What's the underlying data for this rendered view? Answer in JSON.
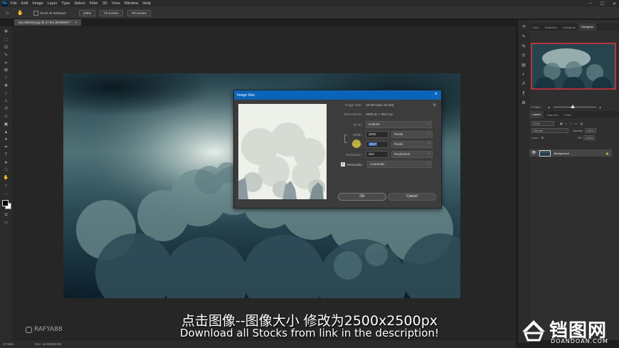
{
  "app": {
    "logo_text": "Ps",
    "menu": [
      "File",
      "Edit",
      "Image",
      "Layer",
      "Type",
      "Select",
      "Filter",
      "3D",
      "View",
      "Window",
      "Help"
    ],
    "window_controls": [
      "–",
      "☐",
      "✕"
    ]
  },
  "options_bar": {
    "scroll_all_label": "Scroll All Windows",
    "zoom_button": "100%",
    "fit_screen_button": "Fit Screen",
    "fill_screen_button": "Fill Screen"
  },
  "document": {
    "tab_title": "sky-690293.jpg @ 27.5% (RGB/8#) *",
    "close": "×"
  },
  "tools": [
    "move-icon",
    "marquee-icon",
    "lasso-icon",
    "quick-select-icon",
    "crop-icon",
    "frame-icon",
    "eyedropper-icon",
    "healing-icon",
    "brush-icon",
    "stamp-icon",
    "history-brush-icon",
    "eraser-icon",
    "gradient-icon",
    "blur-icon",
    "dodge-icon",
    "pen-icon",
    "type-icon",
    "path-select-icon",
    "rectangle-icon",
    "hand-icon",
    "zoom-icon",
    "more-icon"
  ],
  "right_panel": {
    "top_tabs": [
      "Color",
      "Swatches",
      "Histogram",
      "Navigator"
    ],
    "active_top_tab": "Navigator",
    "nav_zoom": "27.55%",
    "layer_tabs": [
      "Layers",
      "Channels",
      "Paths"
    ],
    "active_layer_tab": "Layers",
    "kind_label": "Kind",
    "blend_mode": "Normal",
    "opacity_label": "Opacity:",
    "opacity_value": "100%",
    "lock_label": "Lock:",
    "fill_label": "Fill:",
    "fill_value": "100%",
    "layer_name": "Background"
  },
  "dialog": {
    "title": "Image Size",
    "image_size_label": "Image Size:",
    "image_size_value": "18.0M (was 22.2M)",
    "dimensions_label": "Dimensions:",
    "dimensions_value": "2500 px  ×  2517 px",
    "fit_to_label": "Fit To:",
    "fit_to_value": "Custom",
    "width_label": "Width:",
    "width_value": "2500",
    "width_unit": "Pixels",
    "height_label": "Height:",
    "height_value": "2517",
    "height_unit": "Pixels",
    "resolution_label": "Resolution:",
    "resolution_value": "300",
    "resolution_unit": "Pixels/Inch",
    "resample_label": "Resample:",
    "resample_value": "Automatic",
    "ok_label": "OK",
    "cancel_label": "Cancel"
  },
  "subtitles": {
    "line1": "点击图像--图像大小 修改为2500x2500px",
    "line2": "Download all Stocks from link in the description!"
  },
  "watermark": "RAFYA88",
  "status": {
    "zoom": "27.55%",
    "doc": "Doc: 18.0M/18.0M"
  },
  "logo": {
    "chinese": "铛图网",
    "latin": "DOANDOAN.COM"
  }
}
